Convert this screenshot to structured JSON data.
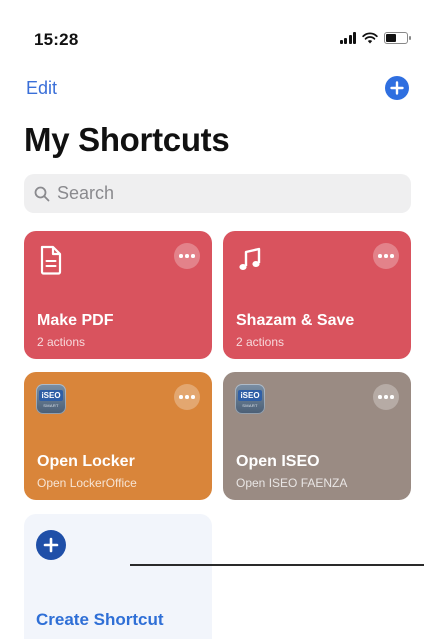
{
  "status_bar": {
    "time": "15:28",
    "battery_level": 0.5
  },
  "nav": {
    "edit_label": "Edit",
    "add_icon": "plus-circle-icon"
  },
  "page_title": "My Shortcuts",
  "search": {
    "placeholder": "Search",
    "value": ""
  },
  "shortcuts": [
    {
      "title": "Make PDF",
      "subtitle": "2 actions",
      "color": "#d9535e",
      "icon": "document-icon"
    },
    {
      "title": "Shazam & Save",
      "subtitle": "2 actions",
      "color": "#d9535e",
      "icon": "music-note-icon"
    },
    {
      "title": "Open Locker",
      "subtitle": "Open LockerOffice",
      "color": "#d9853a",
      "icon": "iseo-app-icon"
    },
    {
      "title": "Open ISEO",
      "subtitle": "Open ISEO FAENZA",
      "color": "#9a8b83",
      "icon": "iseo-app-icon"
    }
  ],
  "app_badge": {
    "name": "iSEO",
    "tag": "SMART"
  },
  "create": {
    "label": "Create Shortcut",
    "color": "#2f6fd6"
  }
}
